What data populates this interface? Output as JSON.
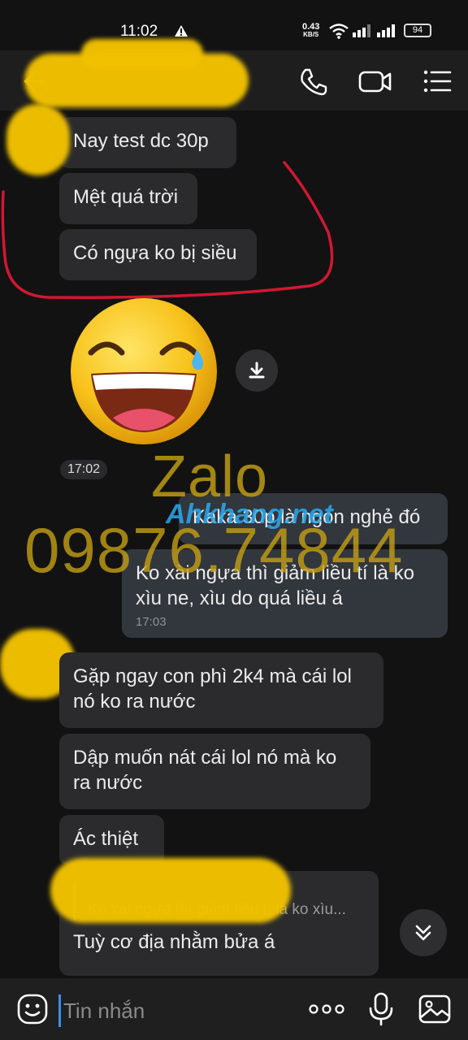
{
  "status_bar": {
    "time": "11:02",
    "net_speed_value": "0.43",
    "net_speed_unit": "KB/S",
    "battery": "94"
  },
  "header": {
    "title": ""
  },
  "messages": {
    "m1": "Nay test dc 30p",
    "m2": "Mệt quá trời",
    "m3": "Có ngựa ko bị siều",
    "sticker_time": "17:02",
    "m4": "Kaka 30p là ngon nghẻ đó",
    "m5": "Ko xài ngựa thì giảm liều tí là ko xìu ne, xìu do quá liều á",
    "m5_time": "17:03",
    "m6": "Gặp ngay con phì 2k4 mà cái lol nó ko ra nước",
    "m7": "Dập muốn nát cái lol nó mà ko ra nước",
    "m8": "Ác thiệt",
    "m9_reply_name": "",
    "m9_reply_text": "Ko xài ngựa thì giảm liều tí là ko xìu...",
    "m9": "Tuỳ cơ địa nhằm bửa á"
  },
  "watermark": {
    "zalo": "Zalo",
    "phone": "09876.74844",
    "site": "Ahkhang.net"
  },
  "input": {
    "placeholder": "Tin nhắn"
  },
  "colors": {
    "accent": "#3d8ee6",
    "bubble_in": "#2b2b2d",
    "bubble_out": "#32363d",
    "background": "#121212"
  }
}
